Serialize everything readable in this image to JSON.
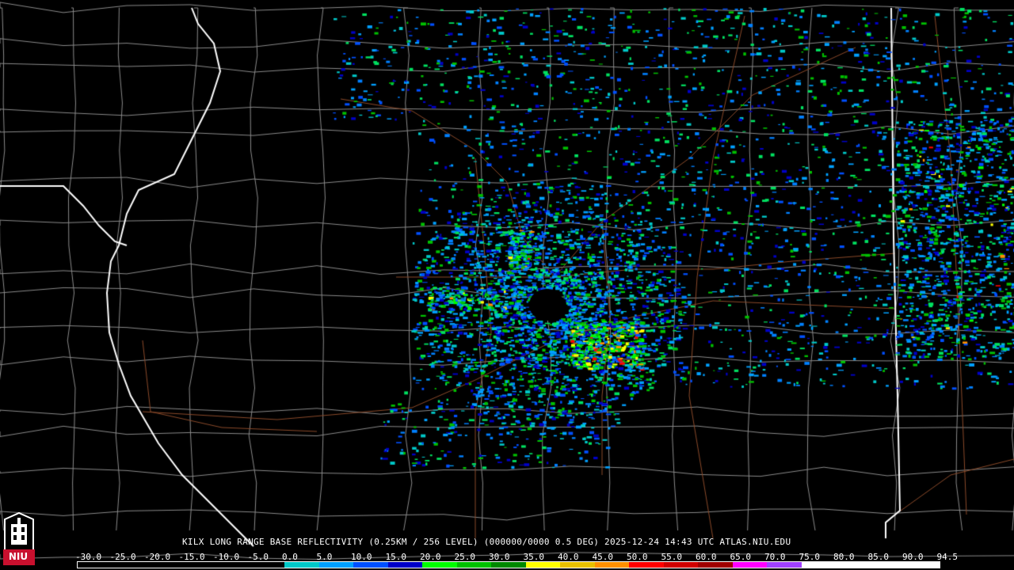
{
  "product": {
    "title": "KILX LONG RANGE BASE REFLECTIVITY (0.25KM / 256 LEVEL) (000000/0000 0.5 DEG) 2025-12-24 14:43 UTC  ATLAS.NIU.EDU",
    "radar_site": "KILX"
  },
  "logo": {
    "text": "NIU"
  },
  "colorbar": {
    "labels": [
      "-30.0",
      "-25.0",
      "-20.0",
      "-15.0",
      "-10.0",
      "-5.0",
      "0.0",
      "5.0",
      "10.0",
      "15.0",
      "20.0",
      "25.0",
      "30.0",
      "35.0",
      "40.0",
      "45.0",
      "50.0",
      "55.0",
      "60.0",
      "65.0",
      "70.0",
      "75.0",
      "80.0",
      "85.0",
      "90.0",
      "94.5"
    ],
    "colors": [
      "#000000",
      "#000000",
      "#000000",
      "#000000",
      "#000000",
      "#000000",
      "#00c8c8",
      "#00a0ff",
      "#0050ff",
      "#0000c8",
      "#00ff00",
      "#00c000",
      "#008800",
      "#ffff00",
      "#e8c000",
      "#ff9000",
      "#ff0000",
      "#d00000",
      "#a00000",
      "#ff00ff",
      "#a040ff",
      "#ffffff",
      "#ffffff",
      "#ffffff",
      "#ffffff"
    ]
  },
  "colors": {
    "background": "#000000",
    "state_border": "#ffffff",
    "county_border": "#8a8a8a",
    "highway": "#8b4a2a"
  }
}
